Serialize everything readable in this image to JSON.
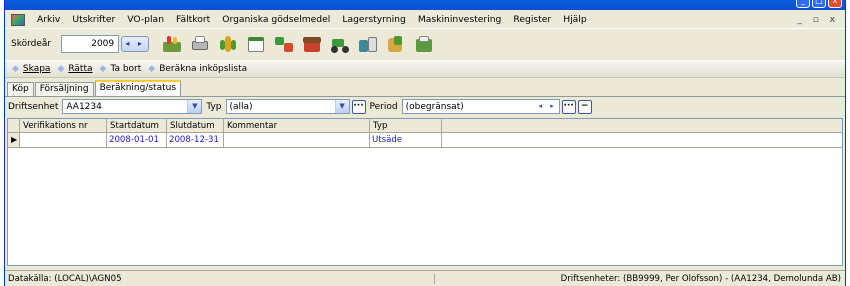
{
  "menu": {
    "items": [
      "Arkiv",
      "Utskrifter",
      "VO-plan",
      "Fältkort",
      "Organiska gödselmedel",
      "Lagerstyrning",
      "Maskininvestering",
      "Register",
      "Hjälp"
    ],
    "mdi_controls": "_ ▫ x"
  },
  "toolbar": {
    "year_label": "Skördeår",
    "year_value": "2009",
    "year_spin": "◂ ▸"
  },
  "actions": {
    "create": "Skapa",
    "edit": "Rätta",
    "delete": "Ta bort",
    "calc": "Beräkna inköpslista"
  },
  "tabs": [
    "Köp",
    "Försäljning",
    "Beräkning/status"
  ],
  "filters": {
    "driftsenhet_label": "Driftsenhet",
    "driftsenhet_value": "AA1234",
    "typ_label": "Typ",
    "typ_value": "(alla)",
    "period_label": "Period",
    "period_value": "(obegränsat)"
  },
  "grid": {
    "columns": [
      "Verifikations nr",
      "Startdatum",
      "Slutdatum",
      "Kommentar",
      "Typ"
    ],
    "rows": [
      {
        "indicator": "▶",
        "verifikation": "",
        "start": "2008-01-01",
        "slut": "2008-12-31",
        "kommentar": "",
        "typ": "Utsäde"
      }
    ]
  },
  "status": {
    "source": "Datakälla: (LOCAL)\\AGN05",
    "units": "Driftsenheter: (BB9999, Per Olofsson) - (AA1234, Demolunda AB)"
  }
}
